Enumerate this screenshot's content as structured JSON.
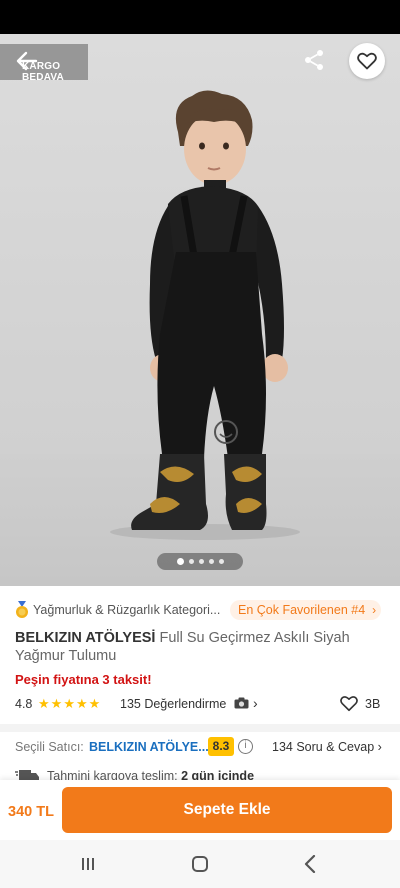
{
  "header": {
    "kargo_line1": "KARGO",
    "kargo_line2": "BEDAVA"
  },
  "gallery": {
    "image_count": 5,
    "active_index": 0
  },
  "breadcrumb": {
    "category": "Yağmurluk & Rüzgarlık Kategori...",
    "favorite_badge": "En Çok Favorilenen #4"
  },
  "product": {
    "brand": "BELKIZIN ATÖLYESİ",
    "name": "Full Su Geçirmez Askılı Siyah Yağmur Tulumu",
    "installment": "Peşin fiyatına 3 taksit!",
    "rating": "4.8",
    "rating_stars": 5,
    "reviews": "135 Değerlendirme",
    "favorites": "3B"
  },
  "seller": {
    "label": "Seçili Satıcı:",
    "name": "BELKIZIN ATÖLYE...",
    "score": "8.3",
    "qa": "134 Soru & Cevap"
  },
  "shipping": {
    "label": "Tahmini kargoya teslim:",
    "value": "2 gün içinde"
  },
  "cart": {
    "price": "340 TL",
    "button": "Sepete Ekle"
  },
  "colors": {
    "accent": "#f27a1a",
    "star": "#ffc000",
    "link": "#1a6fbf",
    "alert": "#d21313"
  }
}
